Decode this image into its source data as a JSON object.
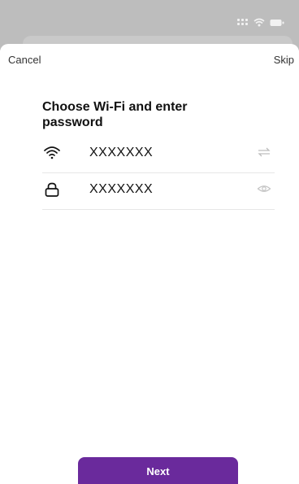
{
  "navigation": {
    "cancel_label": "Cancel",
    "skip_label": "Skip"
  },
  "main": {
    "title": "Choose Wi-Fi and enter password",
    "wifi_row": {
      "value": "XXXXXXX",
      "icon": "wifi-icon",
      "trailing_icon": "swap-icon"
    },
    "password_row": {
      "value": "XXXXXXX",
      "icon": "lock-icon",
      "trailing_icon": "eye-icon"
    }
  },
  "footer": {
    "next_label": "Next"
  },
  "colors": {
    "accent": "#6a2a9c"
  }
}
